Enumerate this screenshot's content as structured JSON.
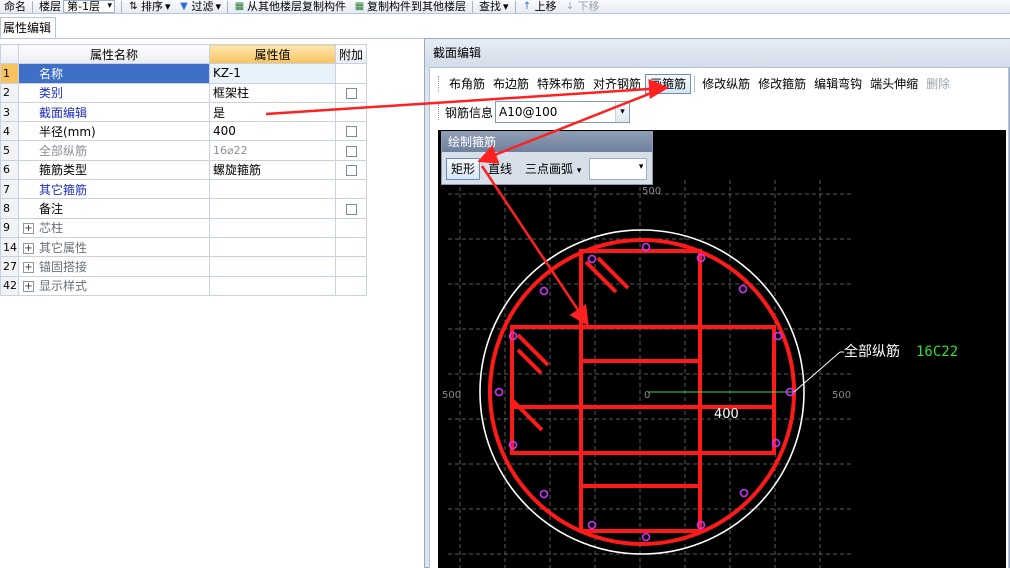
{
  "top_toolbar": {
    "name_label": "命名",
    "floor_label": "楼层",
    "floor_value": "第-1层",
    "sort_label": "排序",
    "filter_label": "过滤",
    "copy_from_label": "从其他楼层复制构件",
    "copy_to_label": "复制构件到其他楼层",
    "find_label": "查找",
    "move_up_label": "上移",
    "move_down_label": "下移"
  },
  "left_panel": {
    "tab_label": "属性编辑",
    "headers": {
      "name": "属性名称",
      "value": "属性值",
      "extra": "附加"
    },
    "rows": [
      {
        "num": "1",
        "name": "名称",
        "value": "KZ-1",
        "has_check": false
      },
      {
        "num": "2",
        "name": "类别",
        "value": "框架柱",
        "has_check": true
      },
      {
        "num": "3",
        "name": "截面编辑",
        "value": "是",
        "has_check": false
      },
      {
        "num": "4",
        "name": "半径(mm)",
        "value": "400",
        "has_check": true
      },
      {
        "num": "5",
        "name": "全部纵筋",
        "value": "16⌀22",
        "has_check": true
      },
      {
        "num": "6",
        "name": "箍筋类型",
        "value": "螺旋箍筋",
        "has_check": true
      },
      {
        "num": "7",
        "name": "其它箍筋",
        "value": "",
        "has_check": false
      },
      {
        "num": "8",
        "name": "备注",
        "value": "",
        "has_check": true
      },
      {
        "num": "9",
        "name": "芯柱",
        "value": "",
        "has_check": false
      },
      {
        "num": "14",
        "name": "其它属性",
        "value": "",
        "has_check": false
      },
      {
        "num": "27",
        "name": "锚固搭接",
        "value": "",
        "has_check": false
      },
      {
        "num": "42",
        "name": "显示样式",
        "value": "",
        "has_check": false
      }
    ]
  },
  "section_editor": {
    "title": "截面编辑",
    "toolbar": [
      "布角筋",
      "布边筋",
      "特殊布筋",
      "对齐钢筋",
      "画箍筋",
      "修改纵筋",
      "修改箍筋",
      "编辑弯钩",
      "端头伸缩",
      "删除"
    ],
    "rebar_info_label": "钢筋信息",
    "rebar_info_value": "A10@100",
    "canvas": {
      "axis_label_top": "500",
      "axis_label_left": "500",
      "axis_label_right": "500",
      "axis_label_center": "0",
      "radius_label": "400",
      "rebar_label": "全部纵筋",
      "rebar_spec": "16C22"
    }
  },
  "draw_stirrup_panel": {
    "title": "绘制箍筋",
    "rect_label": "矩形",
    "line_label": "直线",
    "arc_label": "三点画弧"
  },
  "colors": {
    "rebar_red": "#ff1a1a",
    "spec_green": "#33dd33",
    "selection_blue": "#3f6fc7",
    "header_orange": "#f7c35f"
  }
}
